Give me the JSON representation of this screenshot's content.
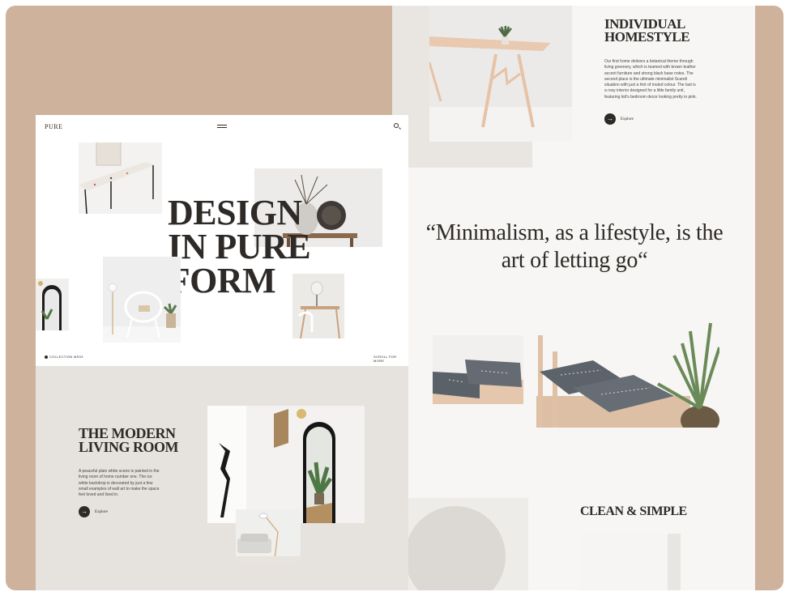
{
  "hero": {
    "logo": "PURE",
    "title_lines": [
      "DESIGN",
      "IN PURE",
      "FORM"
    ],
    "collection": "COLLECTION MS03",
    "scroll": "SCROLL FOR MORE"
  },
  "modern": {
    "title_lines": [
      "THE MODERN",
      "LIVING ROOM"
    ],
    "body": "A peaceful plain white scene is painted in the living room of home number one. The ice white backdrop is decorated by just a few small examples of wall art to make the space feel loved and lived in.",
    "explore": "Explore"
  },
  "individual": {
    "title_lines": [
      "INDIVIDUAL",
      "HOMESTYLE"
    ],
    "body": "Our first home delivers a botanical theme through living greenery, which is teamed with brown leather accent furniture and strong black base notes. The second place is the ultimate minimalist Scandi situation with just a hint of muted colour. The last is a rosy interior designed for a little family unit, featuring kid's bedroom decor looking pretty in pink.",
    "explore": "Explore"
  },
  "quote": "“Minimalism, as a lifestyle, is the art of letting go“",
  "clean": {
    "title": "CLEAN & SIMPLE"
  },
  "colors": {
    "frame": "#cfb29c",
    "ink": "#2e2a27",
    "panel": "#f7f6f4",
    "lower": "#e6e2de"
  },
  "icons": {
    "menu": "hamburger-icon",
    "search": "search-icon",
    "arrow": "arrow-right-icon"
  }
}
